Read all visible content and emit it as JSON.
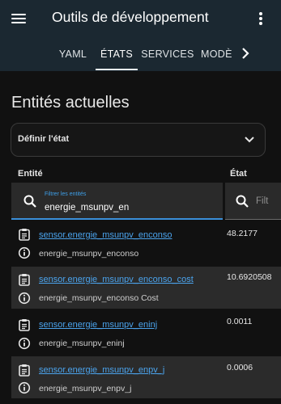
{
  "header": {
    "title": "Outils de développement",
    "tabs": [
      {
        "label": "YAML"
      },
      {
        "label": "ÉTATS"
      },
      {
        "label": "SERVICES"
      },
      {
        "label": "MODÈ"
      }
    ]
  },
  "main": {
    "heading": "Entités actuelles",
    "set_state_label": "Définir l'état",
    "columns": {
      "entity": "Entité",
      "state": "État"
    },
    "entity_filter": {
      "label": "Filtrer les entités",
      "value": "energie_msunpv_en"
    },
    "state_filter": {
      "placeholder": "Filt"
    },
    "rows": [
      {
        "entity_id": "sensor.energie_msunpv_enconso",
        "friendly_name": "energie_msunpv_enconso",
        "state": "48.2177"
      },
      {
        "entity_id": "sensor.energie_msunpv_enconso_cost",
        "friendly_name": "energie_msunpv_enconso Cost",
        "state": "10.6920508"
      },
      {
        "entity_id": "sensor.energie_msunpv_eninj",
        "friendly_name": "energie_msunpv_eninj",
        "state": "0.0011"
      },
      {
        "entity_id": "sensor.energie_msunpv_enpv_j",
        "friendly_name": "energie_msunpv_enpv_j",
        "state": "0.0006"
      }
    ]
  },
  "icons": {
    "menu": "hamburger-menu-icon",
    "more": "more-vert-icon",
    "scroll_tabs": "chevron-right-icon",
    "expand": "chevron-down-icon",
    "search": "search-icon",
    "row_attributes": "clipboard-list-icon",
    "row_info": "info-circle-icon"
  },
  "colors": {
    "header_bg": "#1b2831",
    "page_bg": "#111111",
    "accent": "#3a8fd9",
    "link": "#4ba3ec",
    "row_alt_bg": "#2b2b2b"
  }
}
